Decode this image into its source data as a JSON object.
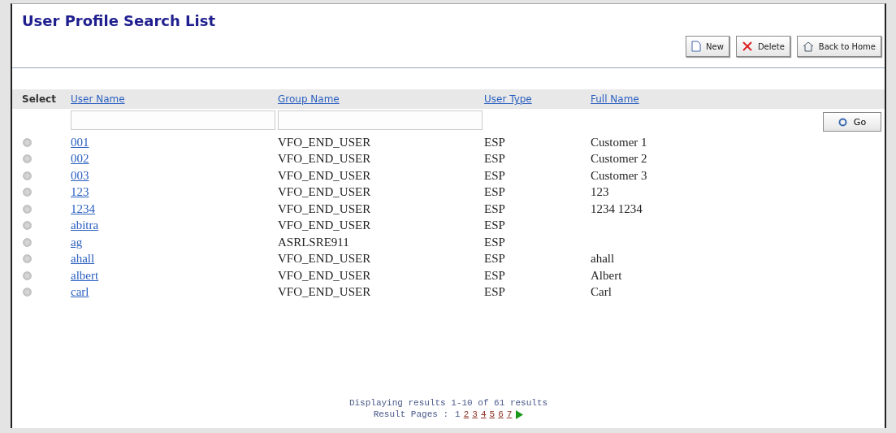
{
  "title": "User Profile Search List",
  "toolbar": [
    {
      "kind": "new",
      "label": "New"
    },
    {
      "kind": "delete",
      "label": "Delete"
    },
    {
      "kind": "home",
      "label": "Back to Home"
    }
  ],
  "table": {
    "select_header": "Select",
    "columns": [
      "User Name",
      "Group Name",
      "User Type",
      "Full Name"
    ],
    "filters": [
      {
        "kind": "text"
      },
      {
        "kind": "text"
      }
    ],
    "go_button": "Go",
    "rows": [
      {
        "selected": false,
        "cells": [
          "001",
          "VFO_END_USER",
          "ESP",
          "Customer 1"
        ]
      },
      {
        "selected": false,
        "cells": [
          "002",
          "VFO_END_USER",
          "ESP",
          "Customer 2"
        ]
      },
      {
        "selected": false,
        "cells": [
          "003",
          "VFO_END_USER",
          "ESP",
          "Customer 3"
        ]
      },
      {
        "selected": false,
        "cells": [
          "123",
          "VFO_END_USER",
          "ESP",
          "123"
        ]
      },
      {
        "selected": false,
        "cells": [
          "1234",
          "VFO_END_USER",
          "ESP",
          "1234 1234"
        ]
      },
      {
        "selected": false,
        "cells": [
          "abitra",
          "VFO_END_USER",
          "ESP",
          ""
        ]
      },
      {
        "selected": false,
        "cells": [
          "ag",
          "ASRLSRE911",
          "ESP",
          ""
        ]
      },
      {
        "selected": false,
        "cells": [
          "ahall",
          "VFO_END_USER",
          "ESP",
          "ahall"
        ]
      },
      {
        "selected": false,
        "cells": [
          "albert",
          "VFO_END_USER",
          "ESP",
          "Albert"
        ]
      },
      {
        "selected": false,
        "cells": [
          "carl",
          "VFO_END_USER",
          "ESP",
          "Carl"
        ]
      }
    ]
  },
  "pagination": {
    "summary": "Displaying results 1-10 of 61 results",
    "label": "Result Pages :",
    "pages": [
      {
        "label": "1",
        "selected": true
      },
      {
        "label": "2",
        "selected": false
      },
      {
        "label": "3",
        "selected": false
      },
      {
        "label": "4",
        "selected": false
      },
      {
        "label": "5",
        "selected": false
      },
      {
        "label": "6",
        "selected": false
      },
      {
        "label": "7",
        "selected": false
      }
    ]
  }
}
